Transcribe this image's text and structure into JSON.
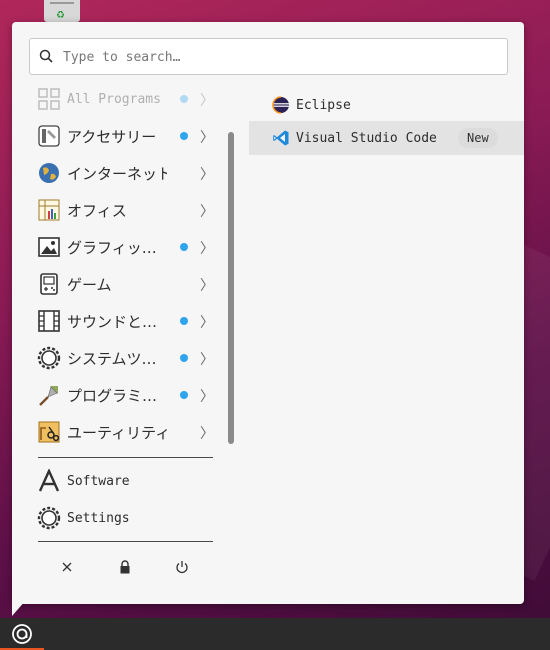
{
  "search": {
    "placeholder": "Type to search…"
  },
  "categories": [
    {
      "label": "All Programs",
      "icon": "grid-icon",
      "new": true,
      "faded": true
    },
    {
      "label": "アクセサリー",
      "icon": "accessories-icon",
      "new": true
    },
    {
      "label": "インターネット",
      "icon": "globe-icon",
      "new": false
    },
    {
      "label": "オフィス",
      "icon": "office-icon",
      "new": false
    },
    {
      "label": "グラフィッ…",
      "icon": "image-icon",
      "new": true
    },
    {
      "label": "ゲーム",
      "icon": "gamepad-icon",
      "new": false
    },
    {
      "label": "サウンドと…",
      "icon": "film-icon",
      "new": true
    },
    {
      "label": "システムツ…",
      "icon": "gear-icon",
      "new": true
    },
    {
      "label": "プログラミ…",
      "icon": "trowel-icon",
      "new": true
    },
    {
      "label": "ユーティリティ",
      "icon": "utilities-icon",
      "new": false
    }
  ],
  "system": [
    {
      "label": "Software",
      "icon": "software-icon"
    },
    {
      "label": "Settings",
      "icon": "settings-icon"
    }
  ],
  "actions": [
    "close-icon",
    "lock-icon",
    "power-icon"
  ],
  "apps": [
    {
      "label": "Eclipse",
      "icon": "eclipse-icon",
      "badge": ""
    },
    {
      "label": "Visual Studio Code",
      "icon": "vscode-icon",
      "badge": "New",
      "selected": true
    }
  ],
  "colors": {
    "accent_dot": "#2fa4ef",
    "menu_bg": "#f6f6f6",
    "taskbar": "#2b2b2b",
    "ubuntu_orange": "#e95420"
  }
}
